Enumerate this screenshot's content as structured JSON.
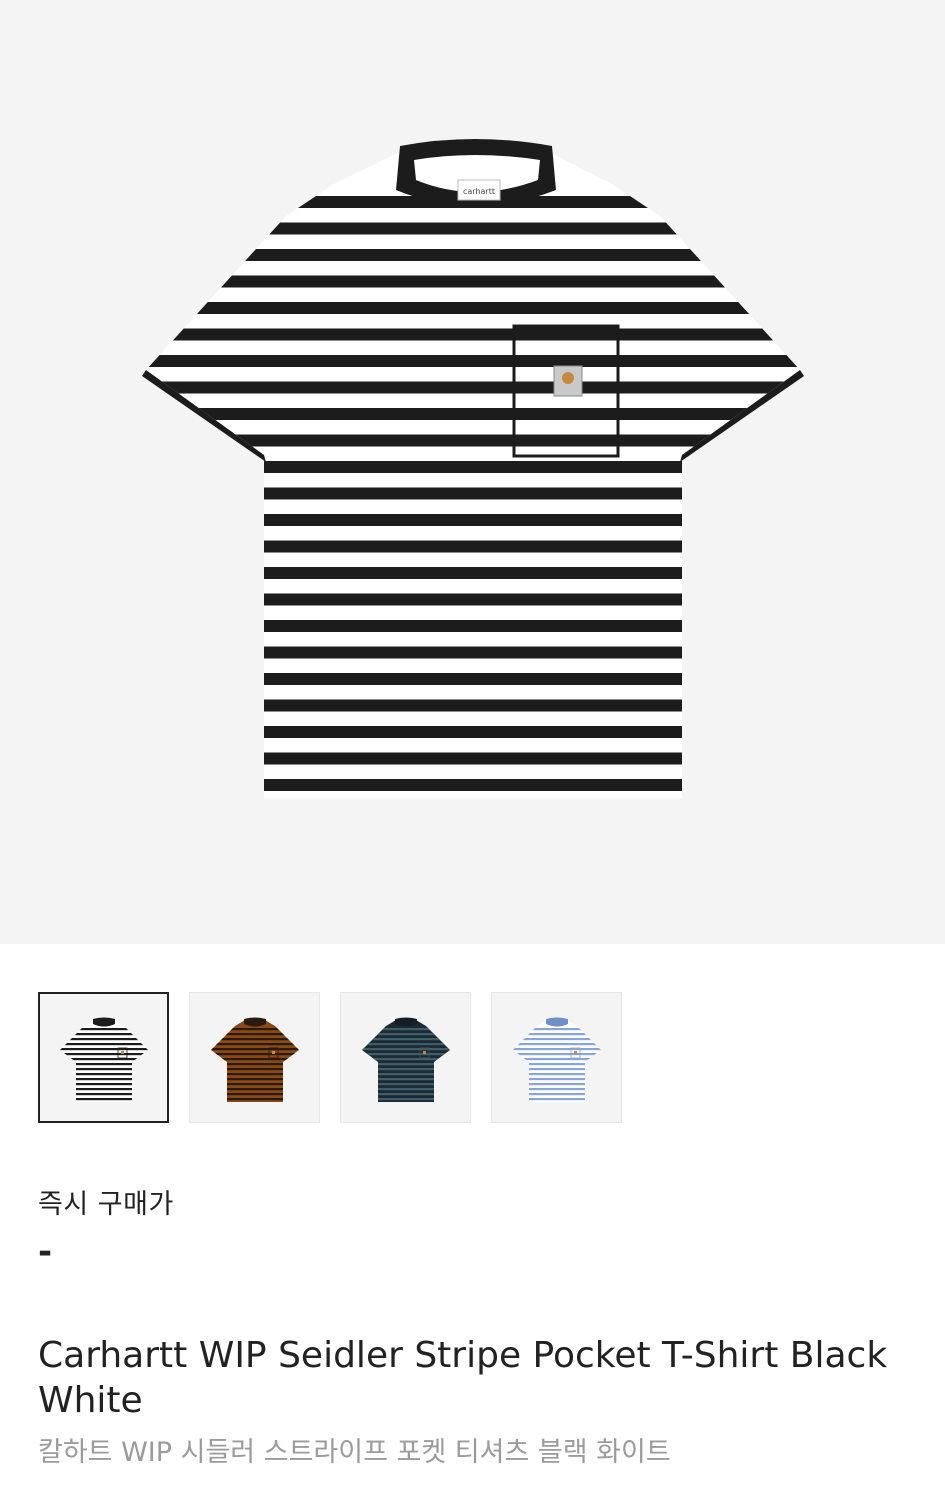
{
  "hero_image": {
    "icon": "striped-tshirt-image",
    "tag_text": "carhartt"
  },
  "thumbnails": [
    {
      "colorway": "black-white",
      "base": "#ffffff",
      "stripe": "#1c1c1c",
      "collar": "#1c1c1c",
      "selected": true
    },
    {
      "colorway": "brown",
      "base": "#8a4a16",
      "stripe": "#2a1a10",
      "collar": "#2a1a10",
      "selected": false
    },
    {
      "colorway": "dark-navy",
      "base": "#1d2a33",
      "stripe": "#3f5e6a",
      "collar": "#151d24",
      "selected": false
    },
    {
      "colorway": "light-blue-white",
      "base": "#ffffff",
      "stripe": "#8aa5d4",
      "collar": "#6f8fc8",
      "selected": false
    }
  ],
  "price": {
    "label": "즉시 구매가",
    "value": "-"
  },
  "product": {
    "title": "Carhartt WIP Seidler Stripe Pocket T-Shirt Black White",
    "subtitle": "칼하트 WIP 시들러 스트라이프 포켓 티셔츠 블랙 화이트"
  }
}
